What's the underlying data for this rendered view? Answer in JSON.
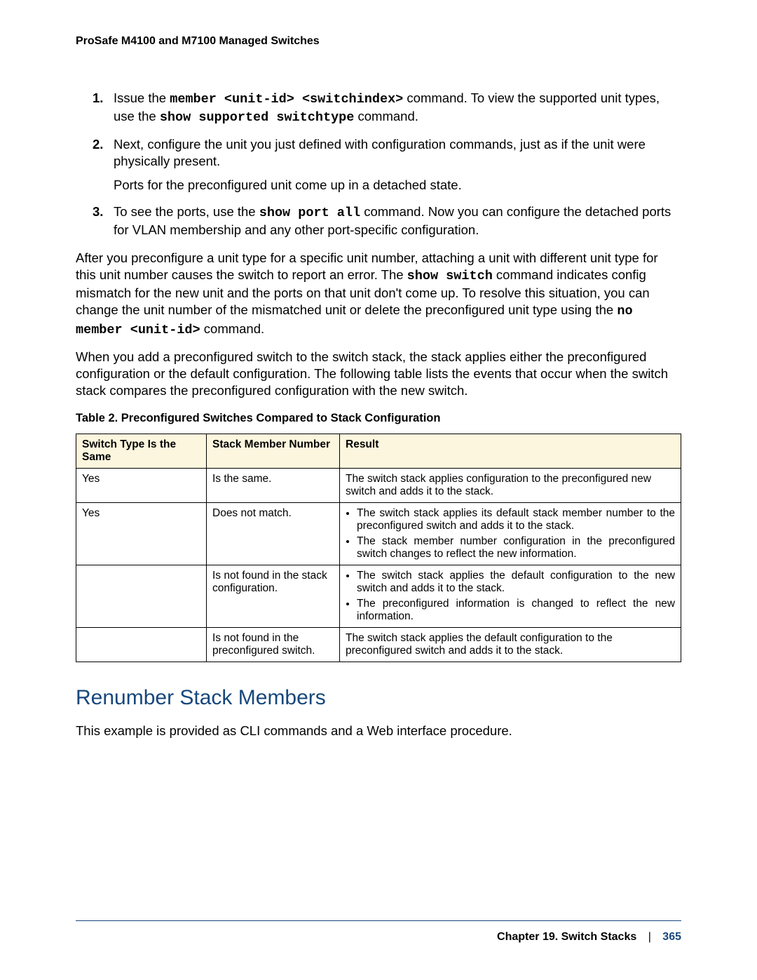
{
  "header": {
    "title": "ProSafe M4100 and M7100 Managed Switches"
  },
  "steps": {
    "s1": {
      "num": "1.",
      "t1": "Issue the ",
      "code1": "member <unit-id> <switchindex>",
      "t2": " command. To view the supported unit types, use the ",
      "code2": "show supported switchtype",
      "t3": " command."
    },
    "s2": {
      "num": "2.",
      "t1": "Next, configure the unit you just defined with configuration commands, just as if the unit were physically present.",
      "sub": "Ports for the preconfigured unit come up in a detached state."
    },
    "s3": {
      "num": "3.",
      "t1": "To see the ports, use the ",
      "code1": "show port all",
      "t2": " command. Now you can configure the detached ports for VLAN membership and any other port-specific configuration."
    }
  },
  "para1": {
    "t1": "After you preconfigure a unit type for a specific unit number, attaching a unit with different unit type for this unit number causes the switch to report an error. The ",
    "code1": "show switch",
    "t2": " command indicates config mismatch for the new unit and the ports on that unit don't come up. To resolve this situation, you can change the unit number of the mismatched unit or delete the preconfigured unit type using the ",
    "code2": "no member <unit-id>",
    "t3": " command."
  },
  "para2": "When you add a preconfigured switch to the switch stack, the stack applies either the preconfigured configuration or the default configuration. The following table lists the events that occur when the switch stack compares the preconfigured configuration with the new switch.",
  "table": {
    "caption": "Table 2.  Preconfigured Switches Compared to Stack Configuration",
    "h1": "Switch Type Is the Same",
    "h2": "Stack Member Number",
    "h3": "Result",
    "r1": {
      "c1": "Yes",
      "c2": "Is the same.",
      "c3": "The switch stack applies configuration to the preconfigured new switch and adds it to the stack."
    },
    "r2": {
      "c1": "Yes",
      "c2": "Does not match.",
      "b1": "The switch stack applies its default stack member number to the preconfigured switch and adds it to the stack.",
      "b2": "The stack member number configuration in the preconfigured switch changes to reflect the new information."
    },
    "r3": {
      "c1": "",
      "c2": "Is not found in the stack configuration.",
      "b1": "The switch stack applies the default configuration to the new switch and adds it to the stack.",
      "b2": "The preconfigured information is changed to reflect the new information."
    },
    "r4": {
      "c1": "",
      "c2": "Is not found in the preconfigured switch.",
      "c3": "The switch stack applies the default configuration to the preconfigured switch and adds it to the stack."
    }
  },
  "section": {
    "heading": "Renumber Stack Members",
    "intro": "This example is provided as CLI commands and a Web interface procedure."
  },
  "footer": {
    "chapter": "Chapter 19.  Switch Stacks",
    "divider": "|",
    "page": "365"
  }
}
